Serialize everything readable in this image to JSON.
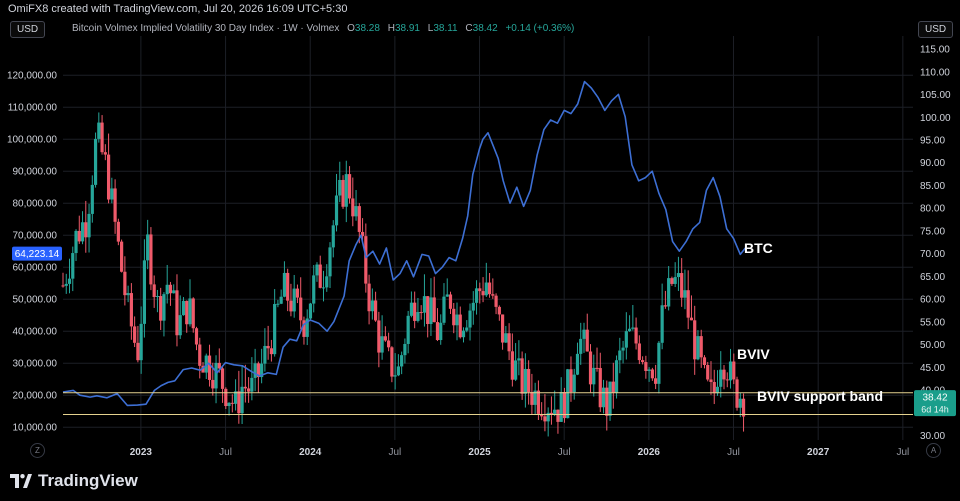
{
  "header": {
    "attribution": "OmiFX8 created with TradingView.com, Jul 20, 2026 16:09 UTC+5:30",
    "left_currency": "USD",
    "right_currency": "USD",
    "symbol": "Bitcoin Volmex Implied Volatility 30 Day Index · 1W · Volmex",
    "o_label": "O",
    "o_value": "38.28",
    "h_label": "H",
    "h_value": "38.91",
    "l_label": "L",
    "l_value": "38.11",
    "c_label": "C",
    "c_value": "38.42",
    "change": "+0.14 (+0.36%)"
  },
  "footer": {
    "brand": "TradingView",
    "goto_left": "Z",
    "goto_right": "A"
  },
  "colors": {
    "background": "#000000",
    "btc_line": "#3d6fd4",
    "up_candle": "#26a69a",
    "down_candle": "#f05a6a",
    "support_line": "#e5d28f",
    "price_tag_btc": "#2962ff",
    "price_tag_bviv": "#1a9e8b"
  },
  "chart_data": {
    "type": "line",
    "left_axis": {
      "ticks": [
        120000,
        110000,
        100000,
        90000,
        80000,
        70000,
        60000,
        50000,
        40000,
        30000,
        20000,
        10000
      ],
      "tick_labels": [
        "120,000.00",
        "110,000.00",
        "100,000.00",
        "90,000.00",
        "80,000.00",
        "70,000.00",
        "60,000.00",
        "50,000.00",
        "40,000.00",
        "30,000.00",
        "20,000.00",
        "10,000.00"
      ],
      "current_price_label": "64,223.14",
      "current_price": 64223.14,
      "range": [
        6000,
        131000
      ]
    },
    "right_axis": {
      "ticks": [
        115,
        110,
        105,
        100,
        95,
        90,
        85,
        80,
        75,
        70,
        65,
        60,
        55,
        50,
        45,
        40,
        35,
        30
      ],
      "tick_labels": [
        "115.00",
        "110.00",
        "105.00",
        "100.00",
        "95.00",
        "90.00",
        "85.00",
        "80.00",
        "75.00",
        "70.00",
        "65.00",
        "60.00",
        "55.00",
        "50.00",
        "45.00",
        "40.00",
        "35.00",
        "30.00"
      ],
      "current_value_label": "38.42",
      "countdown_label": "6d 14h",
      "current_value": 38.42,
      "range": [
        29,
        117
      ]
    },
    "x_axis": {
      "ticks": [
        2023.0,
        2023.5,
        2024.0,
        2024.5,
        2025.0,
        2025.5,
        2026.0,
        2026.5,
        2027.0,
        2027.5
      ],
      "tick_labels": [
        "2023",
        "Jul",
        "2024",
        "Jul",
        "2025",
        "Jul",
        "2026",
        "Jul",
        "2027",
        "Jul"
      ],
      "bold_years": [
        "2023",
        "2024",
        "2025",
        "2026",
        "2027"
      ],
      "range": [
        2022.54,
        2027.56
      ]
    },
    "series": [
      {
        "name": "BTC",
        "axis": "left",
        "x": [
          2022.54,
          2022.6,
          2022.64,
          2022.7,
          2022.74,
          2022.8,
          2022.86,
          2022.92,
          2022.98,
          2023.03,
          2023.08,
          2023.12,
          2023.16,
          2023.2,
          2023.25,
          2023.3,
          2023.35,
          2023.4,
          2023.45,
          2023.5,
          2023.55,
          2023.6,
          2023.65,
          2023.7,
          2023.75,
          2023.8,
          2023.84,
          2023.88,
          2023.92,
          2023.96,
          2024.0,
          2024.05,
          2024.1,
          2024.14,
          2024.17,
          2024.2,
          2024.23,
          2024.27,
          2024.3,
          2024.33,
          2024.37,
          2024.41,
          2024.45,
          2024.49,
          2024.53,
          2024.57,
          2024.61,
          2024.66,
          2024.7,
          2024.74,
          2024.78,
          2024.82,
          2024.86,
          2024.9,
          2024.93,
          2024.96,
          2025.0,
          2025.02,
          2025.05,
          2025.08,
          2025.11,
          2025.14,
          2025.18,
          2025.22,
          2025.26,
          2025.3,
          2025.34,
          2025.38,
          2025.42,
          2025.46,
          2025.5,
          2025.54,
          2025.58,
          2025.62,
          2025.66,
          2025.7,
          2025.74,
          2025.78,
          2025.82,
          2025.86,
          2025.9,
          2025.94,
          2025.98,
          2026.02,
          2026.06,
          2026.1,
          2026.14,
          2026.18,
          2026.22,
          2026.26,
          2026.3,
          2026.34,
          2026.38,
          2026.42,
          2026.46,
          2026.5,
          2026.54,
          2026.57
        ],
        "values": [
          21000,
          21500,
          20000,
          19400,
          19800,
          19200,
          20500,
          16800,
          16900,
          17200,
          21500,
          23000,
          24000,
          24500,
          28000,
          28500,
          27800,
          30000,
          27000,
          30200,
          29500,
          29200,
          27500,
          26000,
          27000,
          26500,
          35000,
          37500,
          37000,
          42000,
          43500,
          42500,
          40000,
          43000,
          47000,
          51000,
          62000,
          67000,
          70000,
          63000,
          65000,
          61000,
          66000,
          56000,
          58000,
          62000,
          57000,
          64000,
          63500,
          58000,
          60000,
          63000,
          62000,
          69000,
          76000,
          89000,
          97000,
          100000,
          102000,
          98000,
          94000,
          87000,
          80000,
          85000,
          79000,
          84000,
          95000,
          103000,
          106000,
          105000,
          109000,
          108000,
          111000,
          118000,
          116000,
          113000,
          109000,
          112000,
          114000,
          107000,
          92000,
          87000,
          88000,
          90000,
          83000,
          78000,
          68000,
          65000,
          68000,
          72000,
          74000,
          84000,
          88000,
          82000,
          72000,
          69000,
          64000,
          66000
        ]
      },
      {
        "name": "BVIV",
        "axis": "right",
        "x": [
          2022.54,
          2022.62,
          2022.68,
          2022.74,
          2022.8,
          2022.86,
          2022.92,
          2022.98,
          2023.04,
          2023.1,
          2023.16,
          2023.22,
          2023.28,
          2023.34,
          2023.4,
          2023.46,
          2023.52,
          2023.56,
          2023.6,
          2023.66,
          2023.72,
          2023.78,
          2023.84,
          2023.9,
          2023.96,
          2024.02,
          2024.08,
          2024.14,
          2024.18,
          2024.22,
          2024.26,
          2024.3,
          2024.34,
          2024.4,
          2024.46,
          2024.52,
          2024.58,
          2024.64,
          2024.7,
          2024.76,
          2024.82,
          2024.88,
          2024.94,
          2025.0,
          2025.04,
          2025.08,
          2025.12,
          2025.18,
          2025.24,
          2025.3,
          2025.36,
          2025.42,
          2025.48,
          2025.54,
          2025.58,
          2025.62,
          2025.66,
          2025.7,
          2025.76,
          2025.82,
          2025.88,
          2025.94,
          2026.0,
          2026.04,
          2026.08,
          2026.14,
          2026.18,
          2026.22,
          2026.26,
          2026.3,
          2026.34,
          2026.38,
          2026.42,
          2026.46,
          2026.5,
          2026.54,
          2026.57
        ],
        "values": [
          63,
          74,
          78,
          96,
          88,
          73,
          58,
          48,
          72,
          58,
          64,
          54,
          59,
          48,
          46,
          43,
          39,
          36,
          41,
          40,
          46,
          53,
          62,
          59,
          55,
          63,
          66,
          77,
          83,
          86,
          80,
          72,
          62,
          52,
          46,
          44,
          56,
          62,
          57,
          52,
          61,
          55,
          58,
          62,
          64,
          58,
          54,
          48,
          42,
          40,
          38,
          37,
          36,
          42,
          52,
          49,
          44,
          40,
          36,
          46,
          52,
          50,
          46,
          45,
          56,
          64,
          63,
          59,
          52,
          46,
          40,
          38,
          48,
          46,
          40,
          39,
          38.42
        ]
      }
    ],
    "annotations": [
      {
        "text": "BTC",
        "series": "BTC"
      },
      {
        "text": "BVIV",
        "series": "BVIV"
      },
      {
        "text": "BVIV support band",
        "type": "band",
        "axis": "right",
        "values": [
          34.6,
          39.4
        ]
      }
    ]
  }
}
